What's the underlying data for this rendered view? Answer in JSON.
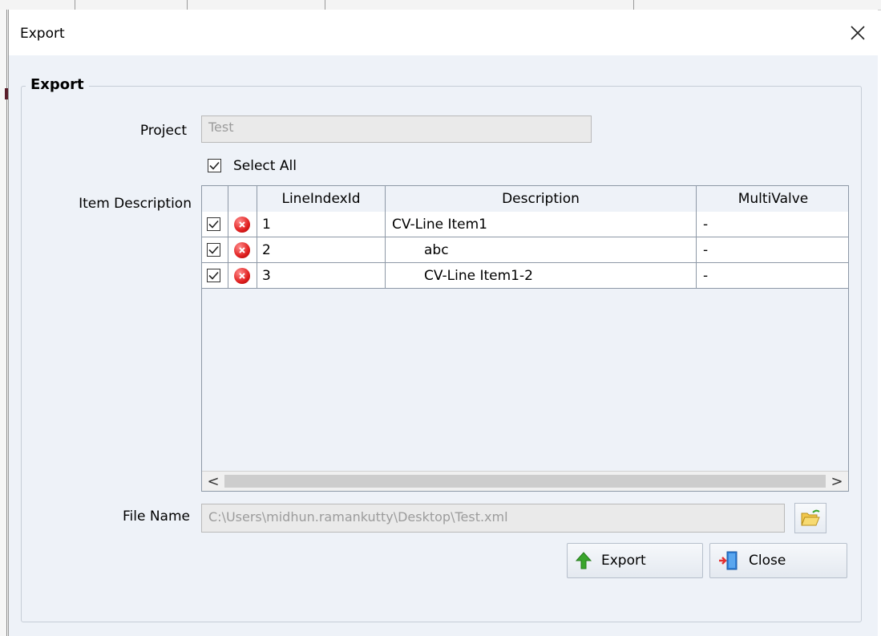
{
  "dialog": {
    "title": "Export"
  },
  "group": {
    "title": "Export"
  },
  "project": {
    "label": "Project",
    "value": "Test"
  },
  "select_all": {
    "label": "Select All",
    "checked": true
  },
  "items": {
    "label": "Item Description",
    "columns": [
      "",
      "",
      "LineIndexId",
      "Description",
      "MultiValve"
    ],
    "rows": [
      {
        "checked": true,
        "line_index_id": "1",
        "description": "CV-Line Item1",
        "multivalve": "-"
      },
      {
        "checked": true,
        "line_index_id": "2",
        "description": "abc",
        "multivalve": "-"
      },
      {
        "checked": true,
        "line_index_id": "3",
        "description": "CV-Line Item1-2",
        "multivalve": "-"
      }
    ],
    "scroll_left": "<",
    "scroll_right": ">"
  },
  "file": {
    "label": "File Name",
    "value": "C:\\Users\\midhun.ramankutty\\Desktop\\Test.xml"
  },
  "buttons": {
    "export_label": "Export",
    "close_label": "Close"
  },
  "icons": {
    "close": "close-icon",
    "check": "check-icon",
    "delete": "delete-icon",
    "folder": "folder-open-icon",
    "export": "arrow-up-icon",
    "exit": "door-exit-icon"
  },
  "colors": {
    "client_bg": "#eef2f8",
    "grid_border": "#8d98a6",
    "delete_red": "#e02020",
    "export_green": "#3aa52c"
  }
}
